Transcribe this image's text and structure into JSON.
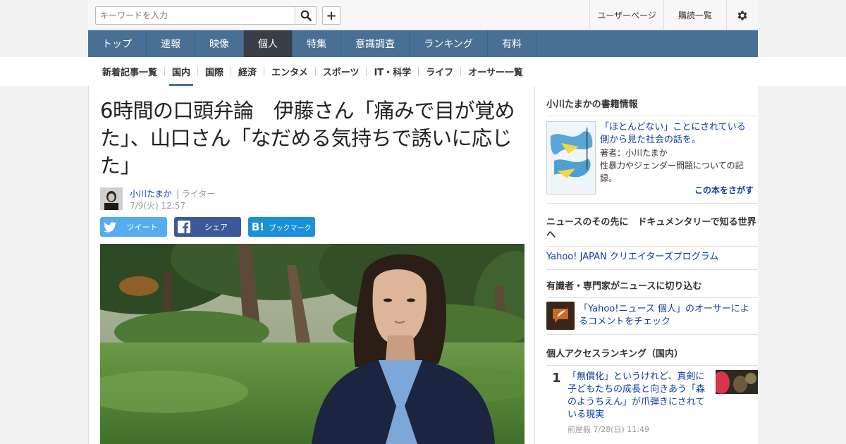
{
  "header": {
    "search_placeholder": "キーワードを入力",
    "user_page": "ユーザーページ",
    "subscribe": "購読一覧"
  },
  "mainnav": [
    "トップ",
    "速報",
    "映像",
    "個人",
    "特集",
    "意識調査",
    "ランキング",
    "有料"
  ],
  "subnav": [
    "新着記事一覧",
    "国内",
    "国際",
    "経済",
    "エンタメ",
    "スポーツ",
    "IT・科学",
    "ライフ",
    "オーサー一覧"
  ],
  "article": {
    "title": "6時間の口頭弁論　伊藤さん「痛みで目が覚めた」、山口さん「なだめる気持ちで誘いに応じた」",
    "author": "小川たまか",
    "role": "| ライター",
    "date": "7/9(火) 12:57",
    "share_twitter": "ツイート",
    "share_facebook": "シェア",
    "share_hatena": "ブックマーク"
  },
  "sidebar": {
    "book_heading": "小川たまかの書籍情報",
    "book_title": "「ほとんどない」ことにされている側から見た社会の話を。",
    "book_author": "著者：小川たまか",
    "book_desc": "性暴力やジェンダー問題についての記録。",
    "book_find": "この本をさがす",
    "doc_heading": "ニュースのその先に　ドキュメンタリーで知る世界へ",
    "doc_link": "Yahoo! JAPAN クリエイターズプログラム",
    "expert_heading": "有識者・専門家がニュースに切り込む",
    "expert_link": "「Yahoo!ニュース 個人」のオーサーによるコメントをチェック",
    "ranking_heading": "個人アクセスランキング（国内）",
    "rank1_num": "1",
    "rank1_title": "「無償化」というけれど、真剣に子どもたちの成長と向きあう「森のようちえん」が爪弾きにされている現実",
    "rank1_meta": "前屋毅  7/28(日) 11:49"
  },
  "colors": {
    "nav_bg": "#4a6f95",
    "nav_active": "#3a3f47",
    "link": "#0b3ba8",
    "twitter": "#55acee",
    "facebook": "#3b5998",
    "hatena": "#1d8fd7"
  }
}
